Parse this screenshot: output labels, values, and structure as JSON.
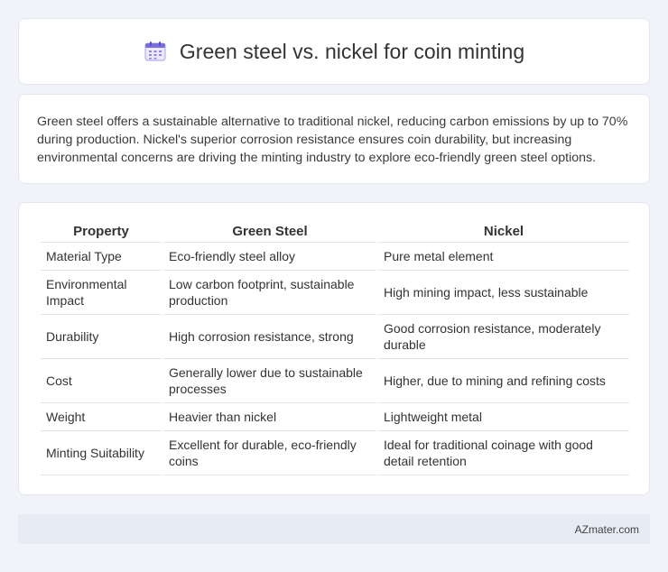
{
  "header": {
    "title": "Green steel vs. nickel for coin minting",
    "icon": "calendar-icon",
    "icon_color": "#7b6fe0"
  },
  "summary": {
    "text": "Green steel offers a sustainable alternative to traditional nickel, reducing carbon emissions by up to 70% during production. Nickel's superior corrosion resistance ensures coin durability, but increasing environmental concerns are driving the minting industry to explore eco-friendly green steel options."
  },
  "table": {
    "headers": [
      "Property",
      "Green Steel",
      "Nickel"
    ],
    "rows": [
      [
        "Material Type",
        "Eco-friendly steel alloy",
        "Pure metal element"
      ],
      [
        "Environmental Impact",
        "Low carbon footprint, sustainable production",
        "High mining impact, less sustainable"
      ],
      [
        "Durability",
        "High corrosion resistance, strong",
        "Good corrosion resistance, moderately durable"
      ],
      [
        "Cost",
        "Generally lower due to sustainable processes",
        "Higher, due to mining and refining costs"
      ],
      [
        "Weight",
        "Heavier than nickel",
        "Lightweight metal"
      ],
      [
        "Minting Suitability",
        "Excellent for durable, eco-friendly coins",
        "Ideal for traditional coinage with good detail retention"
      ]
    ]
  },
  "footer": {
    "brand": "AZmater.com"
  }
}
